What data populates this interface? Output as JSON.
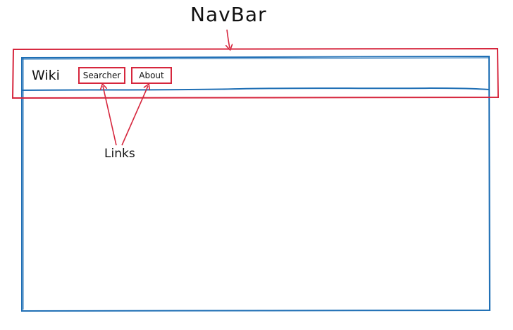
{
  "annotations": {
    "navbar_title": "NavBar",
    "links_label": "Links"
  },
  "navbar": {
    "brand": "Wiki",
    "links": [
      {
        "label": "Searcher"
      },
      {
        "label": "About"
      }
    ]
  },
  "colors": {
    "annotation_red": "#d6263d",
    "wireframe_blue": "#1f6fb5"
  }
}
